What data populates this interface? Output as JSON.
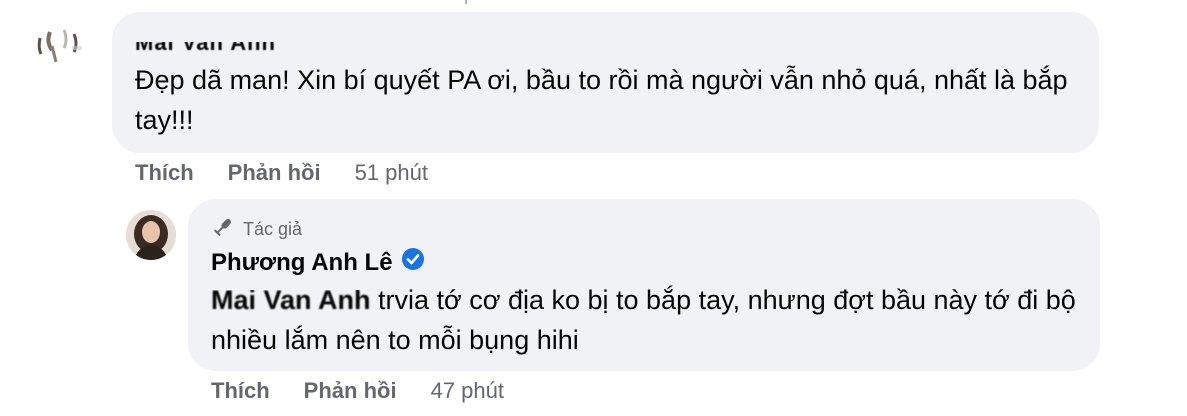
{
  "comment": {
    "author_name": "Mai Van Anh",
    "text": "Đẹp dã man! Xin bí quyết PA ơi, bầu to rồi mà người vẫn nhỏ quá, nhất là bắp tay!!!",
    "like_label": "Thích",
    "reply_label": "Phản hồi",
    "time": "51 phút"
  },
  "reply": {
    "badge": "Tác giả",
    "author_name": "Phương Anh Lê",
    "mention": "Mai Van Anh",
    "text": " trvia tớ cơ địa ko bị to bắp tay, nhưng đợt bầu này tớ đi bộ nhiều lắm nên to mỗi bụng hihi",
    "like_label": "Thích",
    "reply_label": "Phản hồi",
    "time": "47 phút"
  },
  "colors": {
    "bubble": "#f0f2f5",
    "text": "#050505",
    "secondary": "#65676b",
    "verified": "#1b74e4"
  },
  "icons": {
    "author_badge": "microphone-icon",
    "verified": "verified-badge-icon"
  }
}
